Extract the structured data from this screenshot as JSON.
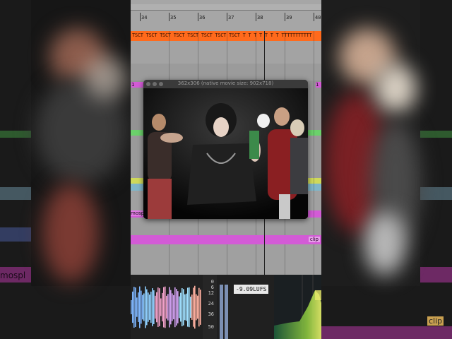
{
  "ruler": {
    "bars": [
      "34",
      "35",
      "36",
      "37",
      "38",
      "39",
      "40"
    ]
  },
  "markers": {
    "text": "TSCT TSCT TSCT TSCT TSCT TSCT TSCT TSCT T T T T T T T TTTTTTTTTTT"
  },
  "video": {
    "title": "362x306 (native movie size: 902x718)"
  },
  "tracks": {
    "left_clip_label": "mosp",
    "clip_label": "clip",
    "small_label": "1"
  },
  "meter": {
    "db_ticks": [
      "0",
      "6",
      "12",
      "24",
      "36",
      "50"
    ],
    "lufs": "-9.09LUFS"
  },
  "backdrop": {
    "left_label": "mospl",
    "right_label": "clip"
  },
  "colors": {
    "marker_orange": "#ff6a1c",
    "clip_magenta": "#d35bd6",
    "lane_green": "#6bd16b",
    "lane_blue": "#5a74c9"
  }
}
